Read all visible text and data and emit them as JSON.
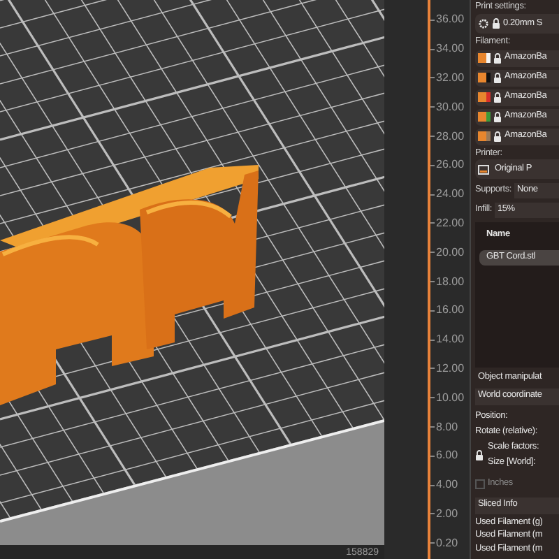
{
  "viewport": {
    "status_text": "158829"
  },
  "layer_slider": {
    "ticks": [
      "36.00",
      "34.00",
      "32.00",
      "30.00",
      "28.00",
      "26.00",
      "24.00",
      "22.00",
      "20.00",
      "18.00",
      "16.00",
      "14.00",
      "12.00",
      "10.00",
      "8.00",
      "6.00",
      "4.00",
      "2.00",
      "0.20"
    ]
  },
  "sidebar": {
    "print_settings": {
      "label": "Print settings:",
      "value": "0.20mm S"
    },
    "filament": {
      "label": "Filament:",
      "items": [
        {
          "name": "AmazonBa",
          "color": "#f4f4f4"
        },
        {
          "name": "AmazonBa",
          "color": "#111111"
        },
        {
          "name": "AmazonBa",
          "color": "#d9302a"
        },
        {
          "name": "AmazonBa",
          "color": "#3c9a3a"
        },
        {
          "name": "AmazonBa",
          "color": "#9a7a5a"
        }
      ]
    },
    "printer": {
      "label": "Printer:",
      "value": "Original P"
    },
    "supports": {
      "label": "Supports:",
      "value": "None"
    },
    "infill": {
      "label": "Infill:",
      "value": "15%"
    },
    "object_list": {
      "header": "Name",
      "items": [
        {
          "name": "GBT Cord.stl",
          "selected": true
        }
      ]
    },
    "object_manipulation": {
      "title": "Object manipulat",
      "coordinate_system": "World coordinate",
      "rows": [
        "Position:",
        "Rotate (relative):"
      ],
      "scale_rows": [
        "Scale factors:",
        "Size [World]:"
      ],
      "inches": {
        "label": "Inches",
        "checked": false
      }
    },
    "sliced_info": {
      "title": "Sliced Info",
      "rows": [
        "Used Filament (g)",
        "Used Filament (m",
        "Used Filament (m"
      ]
    }
  }
}
